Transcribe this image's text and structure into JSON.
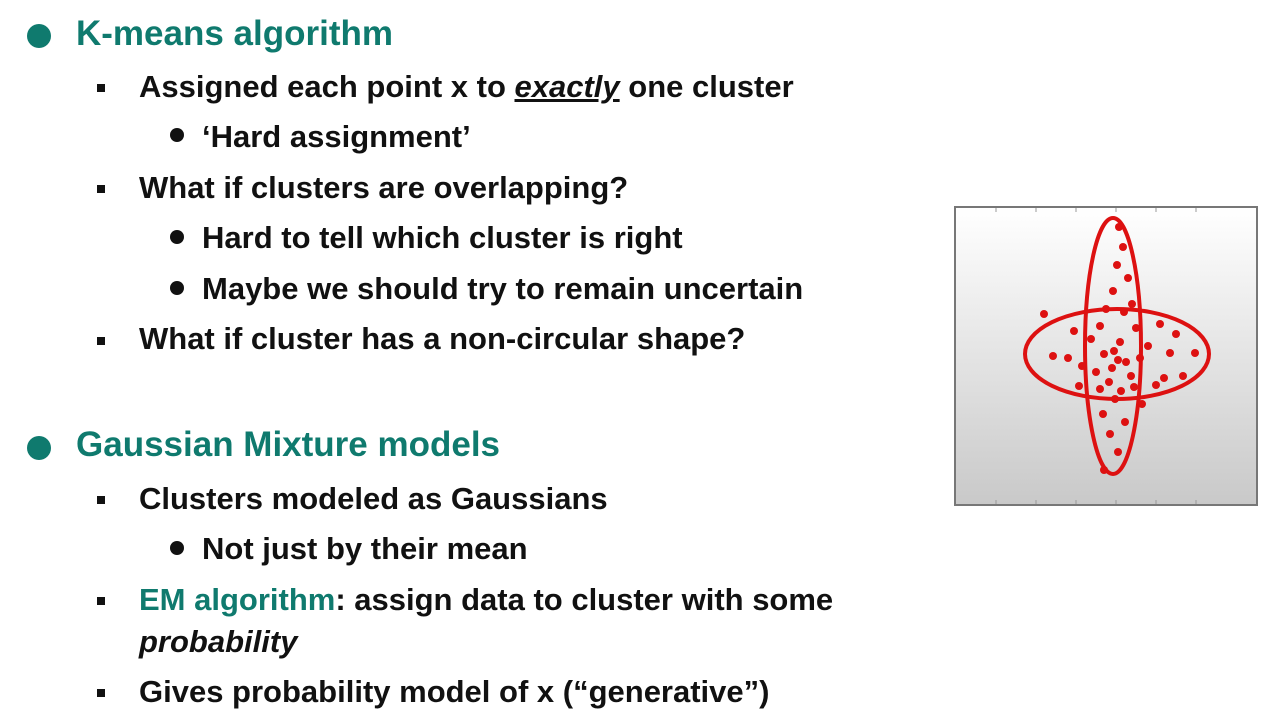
{
  "slide": {
    "sections": [
      {
        "heading": "K-means algorithm",
        "bullets": [
          {
            "pre": "Assigned each point x to ",
            "emph": "exactly",
            "post": " one cluster",
            "sub": [
              "‘Hard assignment’"
            ]
          },
          {
            "text": "What if clusters are overlapping?",
            "sub": [
              "Hard to tell which cluster is right",
              "Maybe we should try to remain uncertain"
            ]
          },
          {
            "text": "What if cluster has a non-circular shape?"
          }
        ]
      },
      {
        "heading": "Gaussian Mixture models",
        "bullets": [
          {
            "text": "Clusters modeled as Gaussians",
            "sub": [
              "Not just by their mean"
            ]
          },
          {
            "highlight": "EM algorithm",
            "rest": ": assign data to cluster with some",
            "emph2": "probability"
          },
          {
            "text": "Gives probability model of x (“generative”)"
          }
        ]
      }
    ]
  },
  "figure": {
    "icon": "overlapping-ellipses-scatter",
    "point_color": "#dd1111",
    "ellipse_color": "#dd1111",
    "frame_color": "#777777"
  }
}
